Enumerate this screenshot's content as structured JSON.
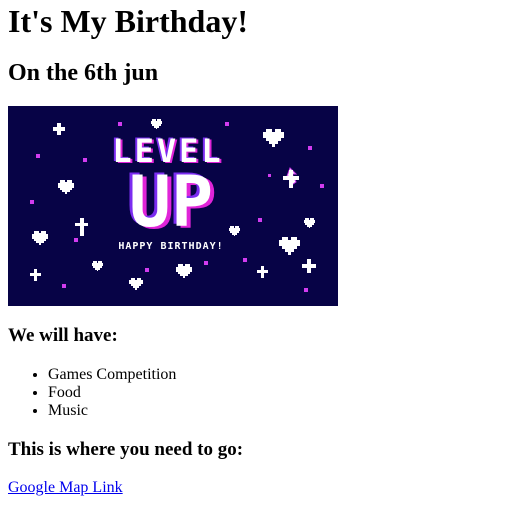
{
  "page": {
    "title": "It's My Birthday!",
    "subtitle": "On the 6th jun"
  },
  "banner": {
    "line1": "LEVEL",
    "line2": "UP",
    "line3": "HAPPY BIRTHDAY!",
    "colors": {
      "background": "#070346",
      "text": "#ffffff",
      "glitch_pink": "#e024d8",
      "glitch_purple": "#7b2cf0"
    }
  },
  "have": {
    "heading": "We will have:",
    "items": [
      "Games Competition",
      "Food",
      "Music"
    ]
  },
  "directions": {
    "heading": "This is where you need to go:",
    "link_label": "Google Map Link"
  }
}
